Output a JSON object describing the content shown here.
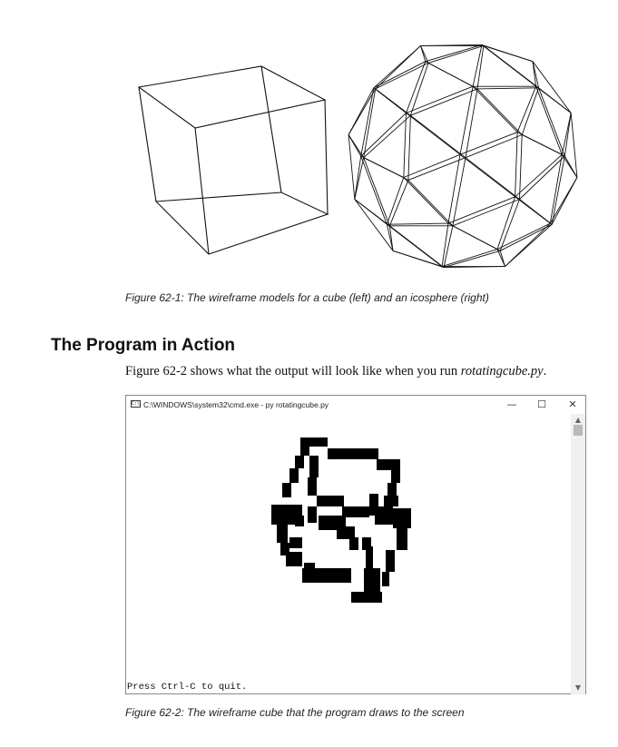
{
  "figure1": {
    "caption": "Figure 62-1: The wireframe models for a cube (left) and an icosphere (right)"
  },
  "section": {
    "heading": "The Program in Action",
    "body_prefix": "Figure 62-2 shows what the output will look like when you run ",
    "body_filename": "rotatingcube.py",
    "body_suffix": "."
  },
  "cmd_window": {
    "title": "C:\\WINDOWS\\system32\\cmd.exe - py  rotatingcube.py",
    "icon_text": "C:\\",
    "minimize_label": "—",
    "maximize_label": "☐",
    "close_label": "✕",
    "console_output": "Press Ctrl-C to quit."
  },
  "figure2": {
    "caption": "Figure 62-2: The wireframe cube that the program draws to the screen"
  },
  "icons": {
    "app": "cmd-icon",
    "minimize": "minimize-icon",
    "maximize": "maximize-icon",
    "close": "close-icon",
    "scroll_up": "chevron-up-icon",
    "scroll_down": "chevron-down-icon"
  }
}
